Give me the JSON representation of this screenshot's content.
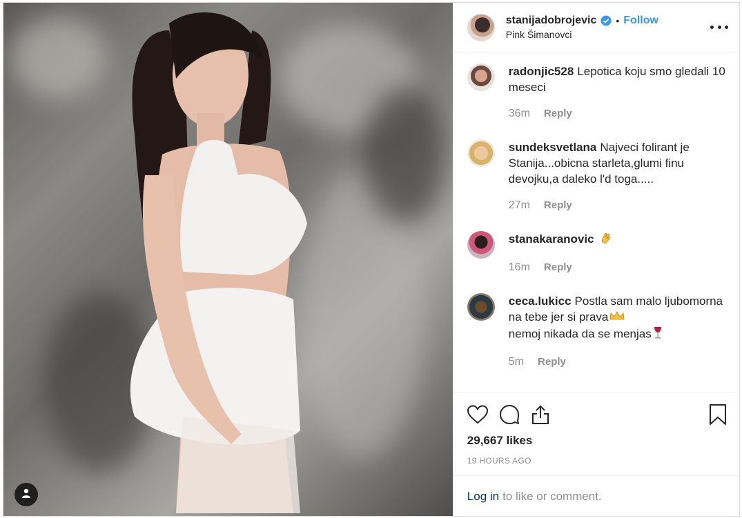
{
  "header": {
    "username": "stanijadobrojevic",
    "verified_icon": "verified-badge-icon",
    "separator": "•",
    "follow_label": "Follow",
    "location": "Pink Šimanovci",
    "more_icon": "more-options-icon"
  },
  "media": {
    "usertag_icon": "user-tag-icon"
  },
  "comments": [
    {
      "username": "radonjic528",
      "text": "Lepotica koju smo gledali 10 meseci",
      "time": "36m",
      "reply": "Reply"
    },
    {
      "username": "sundeksvetlana",
      "text": "Najveci folirant je Stanija...obicna starleta,glumi finu devojku,a daleko l'd toga.....",
      "time": "27m",
      "reply": "Reply"
    },
    {
      "username": "stanakaranovic",
      "text": "",
      "emoji": "clapping-hands-emoji",
      "time": "16m",
      "reply": "Reply"
    },
    {
      "username": "ceca.lukicc",
      "text": "Postla sam malo ljubomorna na tebe jer si prava",
      "text2": "nemoj nikada da se menjas",
      "emoji": "crown-emoji",
      "emoji2": "wine-glass-emoji",
      "time": "5m",
      "reply": "Reply"
    }
  ],
  "actions": {
    "like_icon": "heart-icon",
    "comment_icon": "comment-icon",
    "share_icon": "share-icon",
    "save_icon": "bookmark-icon",
    "likes": "29,667 likes",
    "timestamp": "19 HOURS AGO"
  },
  "login": {
    "link_label": "Log in",
    "rest": "to like or comment."
  },
  "colors": {
    "link_blue": "#3897f0",
    "verified_blue": "#3897f0",
    "text": "#262626",
    "muted": "#8e8e8e",
    "border": "#efefef"
  }
}
